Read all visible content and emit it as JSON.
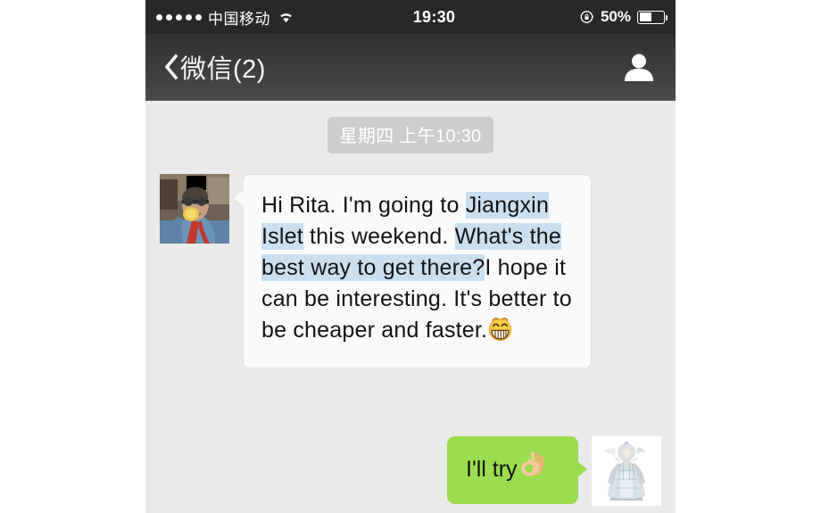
{
  "app": {
    "platform": "ios",
    "screen_bg": "#eaeaea",
    "accent_outgoing": "#9ade4f",
    "selection_highlight": "#cadff0"
  },
  "status_bar": {
    "signal_dots": 5,
    "carrier": "中国移动",
    "wifi_icon": "wifi-icon",
    "time": "19:30",
    "rotation_lock_icon": "rotation-lock-icon",
    "battery_percent_label": "50%",
    "battery_level": 50
  },
  "nav_bar": {
    "back_icon": "back-chevron-icon",
    "title": "微信(2)",
    "contact_icon": "contact-icon"
  },
  "conversation": {
    "timestamp": "星期四 上午10:30",
    "messages": [
      {
        "direction": "incoming",
        "avatar_name": "avatar-incoming",
        "avatar_description": "photo of man with glasses biting a medal",
        "segments": [
          {
            "text": "Hi Rita. I'm going to ",
            "highlight": false
          },
          {
            "text": "Jiangxin Islet",
            "highlight": true
          },
          {
            "text": " this weekend. ",
            "highlight": false
          },
          {
            "text": "What's the best way to get there?",
            "highlight": true
          },
          {
            "text": "I hope it can be interesting. It's better to be cheaper and faster.",
            "highlight": false
          }
        ],
        "full_text": "Hi Rita. I'm going to Jiangxin Islet this weekend. What's the best way to get there?I hope it can be interesting. It's better to be cheaper and faster.",
        "emoji": "😁",
        "emoji_name": "grinning-face-emoji"
      },
      {
        "direction": "outgoing",
        "avatar_name": "avatar-outgoing",
        "avatar_description": "illustration of figure in white robes",
        "text": "I'll try",
        "emoji": "👌",
        "emoji_name": "ok-hand-emoji"
      }
    ]
  }
}
